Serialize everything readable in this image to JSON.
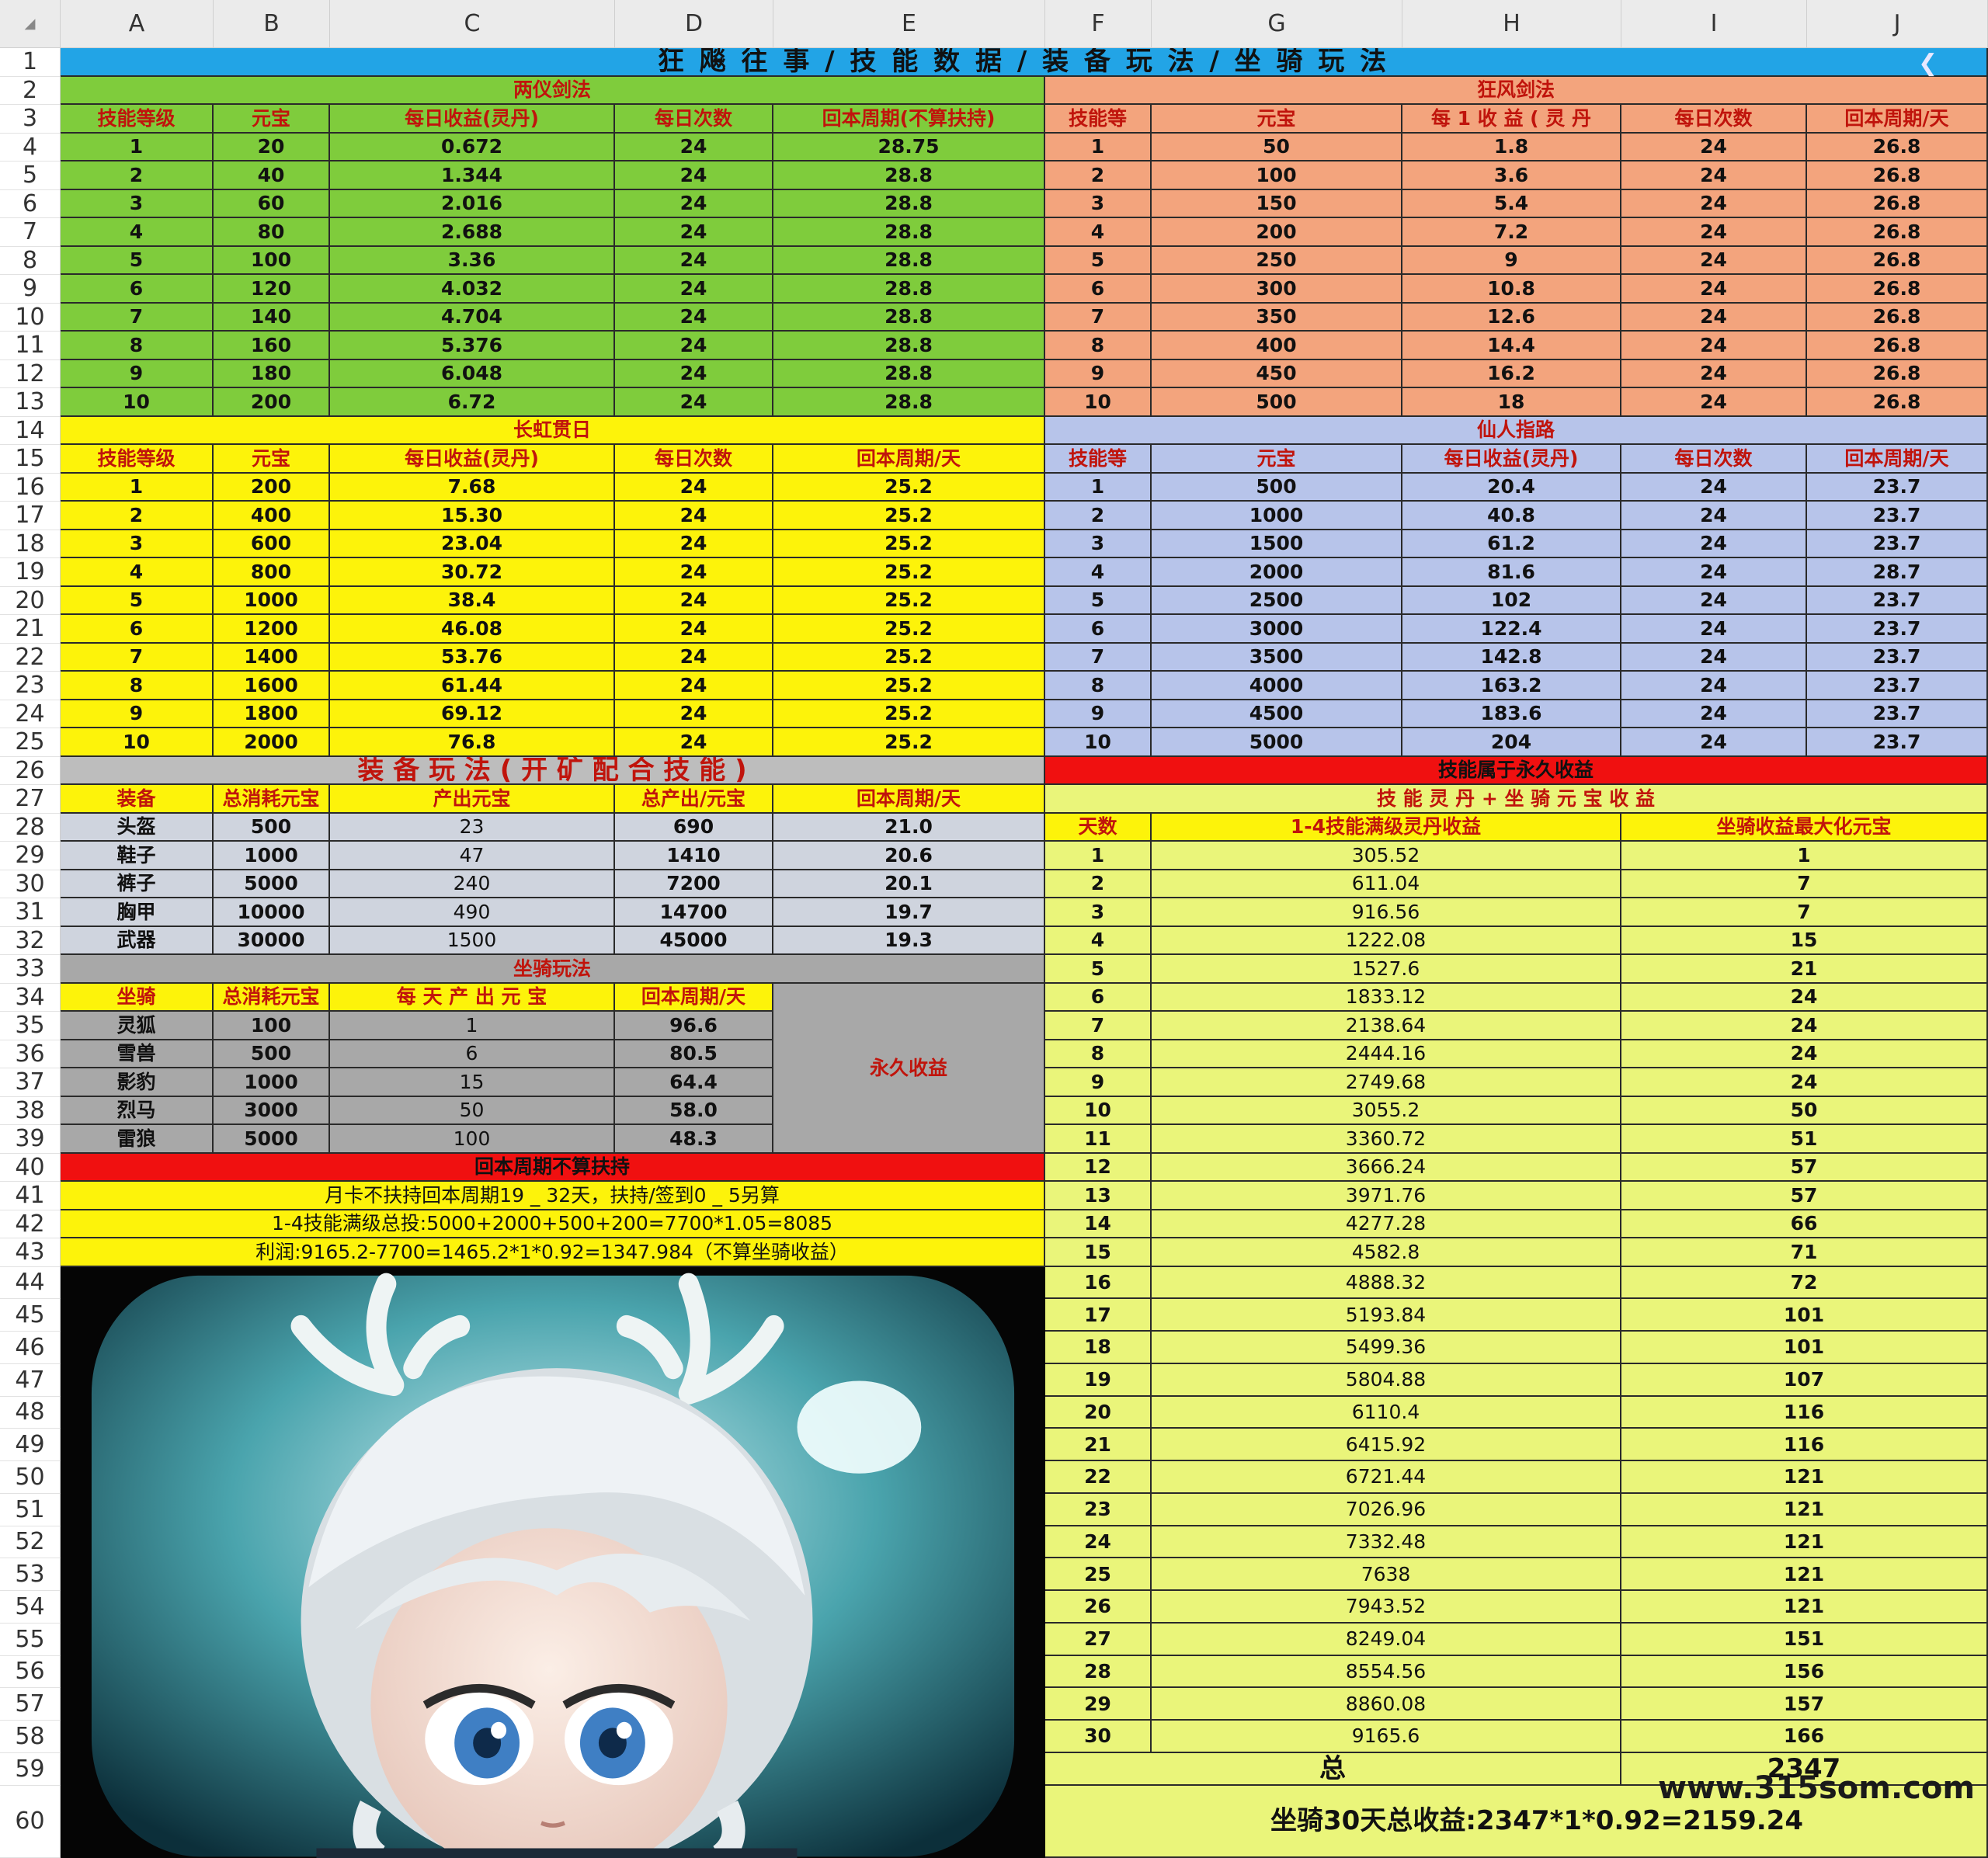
{
  "columns": [
    "A",
    "B",
    "C",
    "D",
    "E",
    "F",
    "G",
    "H",
    "I",
    "J"
  ],
  "rows": [
    "1",
    "2",
    "3",
    "4",
    "5",
    "6",
    "7",
    "8",
    "9",
    "10",
    "11",
    "12",
    "13",
    "14",
    "15",
    "16",
    "17",
    "18",
    "19",
    "20",
    "21",
    "22",
    "23",
    "24",
    "25",
    "26",
    "27",
    "28",
    "29",
    "30",
    "31",
    "32",
    "33",
    "34",
    "35",
    "36",
    "37",
    "38",
    "39",
    "40",
    "41",
    "42",
    "43",
    "44",
    "45",
    "46",
    "47",
    "48",
    "49",
    "50",
    "51",
    "52",
    "53",
    "54",
    "55",
    "56",
    "57",
    "58",
    "59",
    "60"
  ],
  "colors": {
    "title_blue": "#22a4e6",
    "green": "#7fcc3c",
    "orange": "#f3a47d",
    "yellow": "#fdf30a",
    "lavender": "#b7c4ea",
    "gray": "#bdbdbd",
    "light_gray": "#cfd4de",
    "mount_gray": "#a8a8a8",
    "pale_yellow": "#eaf57a",
    "red": "#f01010",
    "header_red_text": "#c0140c"
  },
  "title": "狂 飚 往 事 / 技 能 数 据 / 装 备 玩 法 / 坐 骑 玩 法",
  "green_table": {
    "title": "两仪剑法",
    "headers": [
      "技能等级",
      "元宝",
      "每日收益(灵丹)",
      "每日次数",
      "回本周期(不算扶持)"
    ],
    "rows": [
      [
        "1",
        "20",
        "0.672",
        "24",
        "28.75"
      ],
      [
        "2",
        "40",
        "1.344",
        "24",
        "28.8"
      ],
      [
        "3",
        "60",
        "2.016",
        "24",
        "28.8"
      ],
      [
        "4",
        "80",
        "2.688",
        "24",
        "28.8"
      ],
      [
        "5",
        "100",
        "3.36",
        "24",
        "28.8"
      ],
      [
        "6",
        "120",
        "4.032",
        "24",
        "28.8"
      ],
      [
        "7",
        "140",
        "4.704",
        "24",
        "28.8"
      ],
      [
        "8",
        "160",
        "5.376",
        "24",
        "28.8"
      ],
      [
        "9",
        "180",
        "6.048",
        "24",
        "28.8"
      ],
      [
        "10",
        "200",
        "6.72",
        "24",
        "28.8"
      ]
    ]
  },
  "orange_table": {
    "title": "狂风剑法",
    "headers": [
      "技能等",
      "元宝",
      "每 1 收 益 ( 灵 丹",
      "每日次数",
      "回本周期/天"
    ],
    "rows": [
      [
        "1",
        "50",
        "1.8",
        "24",
        "26.8"
      ],
      [
        "2",
        "100",
        "3.6",
        "24",
        "26.8"
      ],
      [
        "3",
        "150",
        "5.4",
        "24",
        "26.8"
      ],
      [
        "4",
        "200",
        "7.2",
        "24",
        "26.8"
      ],
      [
        "5",
        "250",
        "9",
        "24",
        "26.8"
      ],
      [
        "6",
        "300",
        "10.8",
        "24",
        "26.8"
      ],
      [
        "7",
        "350",
        "12.6",
        "24",
        "26.8"
      ],
      [
        "8",
        "400",
        "14.4",
        "24",
        "26.8"
      ],
      [
        "9",
        "450",
        "16.2",
        "24",
        "26.8"
      ],
      [
        "10",
        "500",
        "18",
        "24",
        "26.8"
      ]
    ]
  },
  "yellow_table": {
    "title": "长虹贯日",
    "headers": [
      "技能等级",
      "元宝",
      "每日收益(灵丹)",
      "每日次数",
      "回本周期/天"
    ],
    "rows": [
      [
        "1",
        "200",
        "7.68",
        "24",
        "25.2"
      ],
      [
        "2",
        "400",
        "15.30",
        "24",
        "25.2"
      ],
      [
        "3",
        "600",
        "23.04",
        "24",
        "25.2"
      ],
      [
        "4",
        "800",
        "30.72",
        "24",
        "25.2"
      ],
      [
        "5",
        "1000",
        "38.4",
        "24",
        "25.2"
      ],
      [
        "6",
        "1200",
        "46.08",
        "24",
        "25.2"
      ],
      [
        "7",
        "1400",
        "53.76",
        "24",
        "25.2"
      ],
      [
        "8",
        "1600",
        "61.44",
        "24",
        "25.2"
      ],
      [
        "9",
        "1800",
        "69.12",
        "24",
        "25.2"
      ],
      [
        "10",
        "2000",
        "76.8",
        "24",
        "25.2"
      ]
    ]
  },
  "lavender_table": {
    "title": "仙人指路",
    "headers": [
      "技能等",
      "元宝",
      "每日收益(灵丹)",
      "每日次数",
      "回本周期/天"
    ],
    "rows": [
      [
        "1",
        "500",
        "20.4",
        "24",
        "23.7"
      ],
      [
        "2",
        "1000",
        "40.8",
        "24",
        "23.7"
      ],
      [
        "3",
        "1500",
        "61.2",
        "24",
        "23.7"
      ],
      [
        "4",
        "2000",
        "81.6",
        "24",
        "28.7"
      ],
      [
        "5",
        "2500",
        "102",
        "24",
        "23.7"
      ],
      [
        "6",
        "3000",
        "122.4",
        "24",
        "23.7"
      ],
      [
        "7",
        "3500",
        "142.8",
        "24",
        "23.7"
      ],
      [
        "8",
        "4000",
        "163.2",
        "24",
        "23.7"
      ],
      [
        "9",
        "4500",
        "183.6",
        "24",
        "23.7"
      ],
      [
        "10",
        "5000",
        "204",
        "24",
        "23.7"
      ]
    ]
  },
  "equip_table": {
    "title": "装 备 玩 法 ( 开 矿 配 合 技 能 )",
    "headers": [
      "装备",
      "总消耗元宝",
      "产出元宝",
      "总产出/元宝",
      "回本周期/天"
    ],
    "rows": [
      [
        "头盔",
        "500",
        "23",
        "690",
        "21.0"
      ],
      [
        "鞋子",
        "1000",
        "47",
        "1410",
        "20.6"
      ],
      [
        "裤子",
        "5000",
        "240",
        "7200",
        "20.1"
      ],
      [
        "胸甲",
        "10000",
        "490",
        "14700",
        "19.7"
      ],
      [
        "武器",
        "30000",
        "1500",
        "45000",
        "19.3"
      ]
    ]
  },
  "mount_table": {
    "title": "坐骑玩法",
    "headers": [
      "坐骑",
      "总消耗元宝",
      "每 天 产 出 元 宝",
      "回本周期/天"
    ],
    "rows": [
      [
        "灵狐",
        "100",
        "1",
        "96.6"
      ],
      [
        "雪兽",
        "500",
        "6",
        "80.5"
      ],
      [
        "影豹",
        "1000",
        "15",
        "64.4"
      ],
      [
        "烈马",
        "3000",
        "50",
        "58.0"
      ],
      [
        "雷狼",
        "5000",
        "100",
        "48.3"
      ]
    ],
    "permanent": "永久收益"
  },
  "notes": {
    "title": "回本周期不算扶持",
    "line1": "月卡不扶持回本周期19 _ 32天，扶持/签到0 _ 5另算",
    "line2": "1-4技能满级总投:5000+2000+500+200=7700*1.05=8085",
    "line3": "利润:9165.2-7700=1465.2*1*0.92=1347.984（不算坐骑收益）"
  },
  "daily_table": {
    "title": "技能属于永久收益",
    "subtitle": "技 能 灵 丹 + 坐 骑 元 宝 收 益",
    "headers": [
      "天数",
      "1-4技能满级灵丹收益",
      "坐骑收益最大化元宝"
    ],
    "rows": [
      [
        "1",
        "305.52",
        "1"
      ],
      [
        "2",
        "611.04",
        "7"
      ],
      [
        "3",
        "916.56",
        "7"
      ],
      [
        "4",
        "1222.08",
        "15"
      ],
      [
        "5",
        "1527.6",
        "21"
      ],
      [
        "6",
        "1833.12",
        "24"
      ],
      [
        "7",
        "2138.64",
        "24"
      ],
      [
        "8",
        "2444.16",
        "24"
      ],
      [
        "9",
        "2749.68",
        "24"
      ],
      [
        "10",
        "3055.2",
        "50"
      ],
      [
        "11",
        "3360.72",
        "51"
      ],
      [
        "12",
        "3666.24",
        "57"
      ],
      [
        "13",
        "3971.76",
        "57"
      ],
      [
        "14",
        "4277.28",
        "66"
      ],
      [
        "15",
        "4582.8",
        "71"
      ],
      [
        "16",
        "4888.32",
        "72"
      ],
      [
        "17",
        "5193.84",
        "101"
      ],
      [
        "18",
        "5499.36",
        "101"
      ],
      [
        "19",
        "5804.88",
        "107"
      ],
      [
        "20",
        "6110.4",
        "116"
      ],
      [
        "21",
        "6415.92",
        "116"
      ],
      [
        "22",
        "6721.44",
        "121"
      ],
      [
        "23",
        "7026.96",
        "121"
      ],
      [
        "24",
        "7332.48",
        "121"
      ],
      [
        "25",
        "7638",
        "121"
      ],
      [
        "26",
        "7943.52",
        "121"
      ],
      [
        "27",
        "8249.04",
        "151"
      ],
      [
        "28",
        "8554.56",
        "156"
      ],
      [
        "29",
        "8860.08",
        "157"
      ],
      [
        "30",
        "9165.6",
        "166"
      ]
    ],
    "total_label": "总",
    "total_value": "2347",
    "summary": "坐骑30天总收益:2347*1*0.92=2159.24"
  },
  "watermark": "www.315som.com",
  "icons": {
    "collapse": "chevron-left-icon",
    "image": "anime-character-portrait"
  }
}
